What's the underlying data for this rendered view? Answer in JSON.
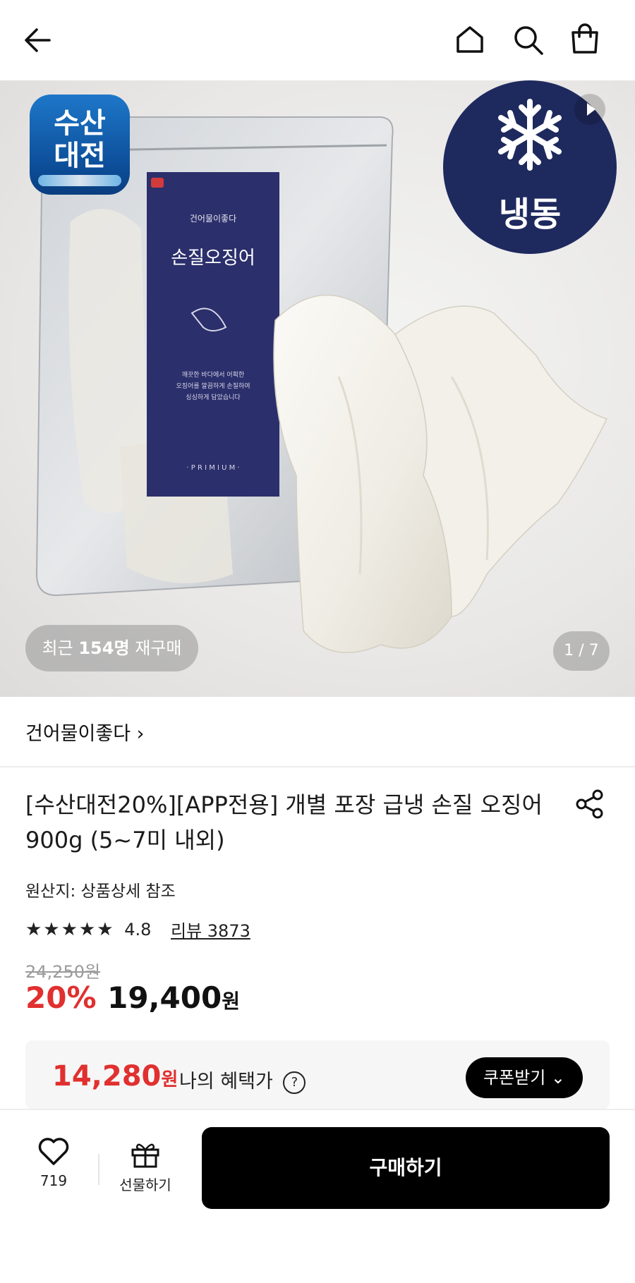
{
  "header": {
    "icons": [
      "back-arrow-icon",
      "home-icon",
      "search-icon",
      "shopping-bag-icon"
    ]
  },
  "hero": {
    "badge_event": "수산\n대전",
    "badge_frozen": "냉동",
    "recent_repurchase_prefix": "최근",
    "recent_repurchase_count": "154명",
    "recent_repurchase_suffix": "재구매",
    "page_indicator": "1 / 7",
    "package_brand": "건어물이좋다",
    "package_title": "손질오징어",
    "package_caption": "깨끗한 바다에서 어획한 오징어를 깔끔하게 손질하여 싱싱하게 담았습니다",
    "package_tier": "· P R I M I U M ·"
  },
  "seller": {
    "name": "건어물이좋다 ›"
  },
  "product": {
    "title": "[수산대전20%][APP전용] 개별 포장 급냉 손질 오징어 900g (5~7미 내외)",
    "origin": "원산지: 상품상세 참조",
    "stars": "★★★★★",
    "rating": "4.8",
    "review_label": "리뷰 3873",
    "original_price": "24,250원",
    "discount": "20%",
    "price": "19,400",
    "price_unit": "원"
  },
  "benefit": {
    "price": "14,280",
    "price_unit": "원",
    "label": "나의 혜택가",
    "help": "?",
    "coupon_button": "쿠폰받기 ⌄"
  },
  "bottom": {
    "wish_count": "719",
    "gift_label": "선물하기",
    "buy_label": "구매하기"
  },
  "colors": {
    "accent_red": "#e0302f",
    "frozen_badge": "#1e2a5e",
    "event_badge": "#0d4f9a",
    "package_navy": "#2b2f6b"
  }
}
